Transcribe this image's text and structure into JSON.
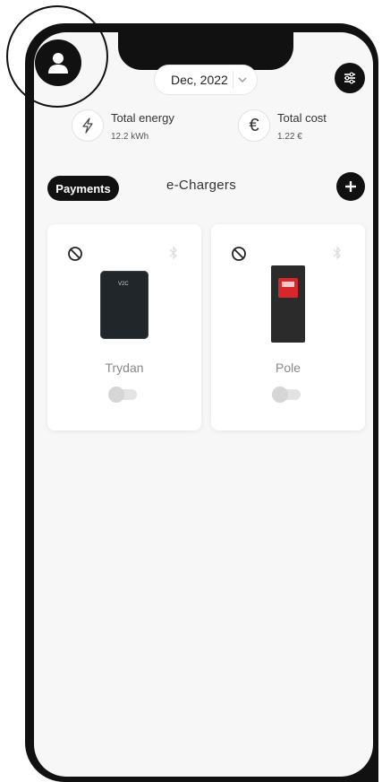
{
  "header": {
    "date": "Dec, 2022"
  },
  "stats": {
    "energy": {
      "label": "Total energy",
      "value": "12.2 kWh",
      "icon": "lightning-icon"
    },
    "cost": {
      "label": "Total cost",
      "value": "1.22 €",
      "icon": "euro-icon",
      "symbol": "€"
    }
  },
  "tabs": [
    {
      "label": "Payments",
      "active": true
    },
    {
      "label": "e-Chargers",
      "active": false
    }
  ],
  "chargers": [
    {
      "name": "Trydan",
      "brand_text": "V2C",
      "enabled": false
    },
    {
      "name": "Pole",
      "enabled": false
    }
  ],
  "colors": {
    "primary": "#111111",
    "background": "#f7f7f7",
    "card": "#ffffff",
    "accent_red": "#d8262a"
  }
}
